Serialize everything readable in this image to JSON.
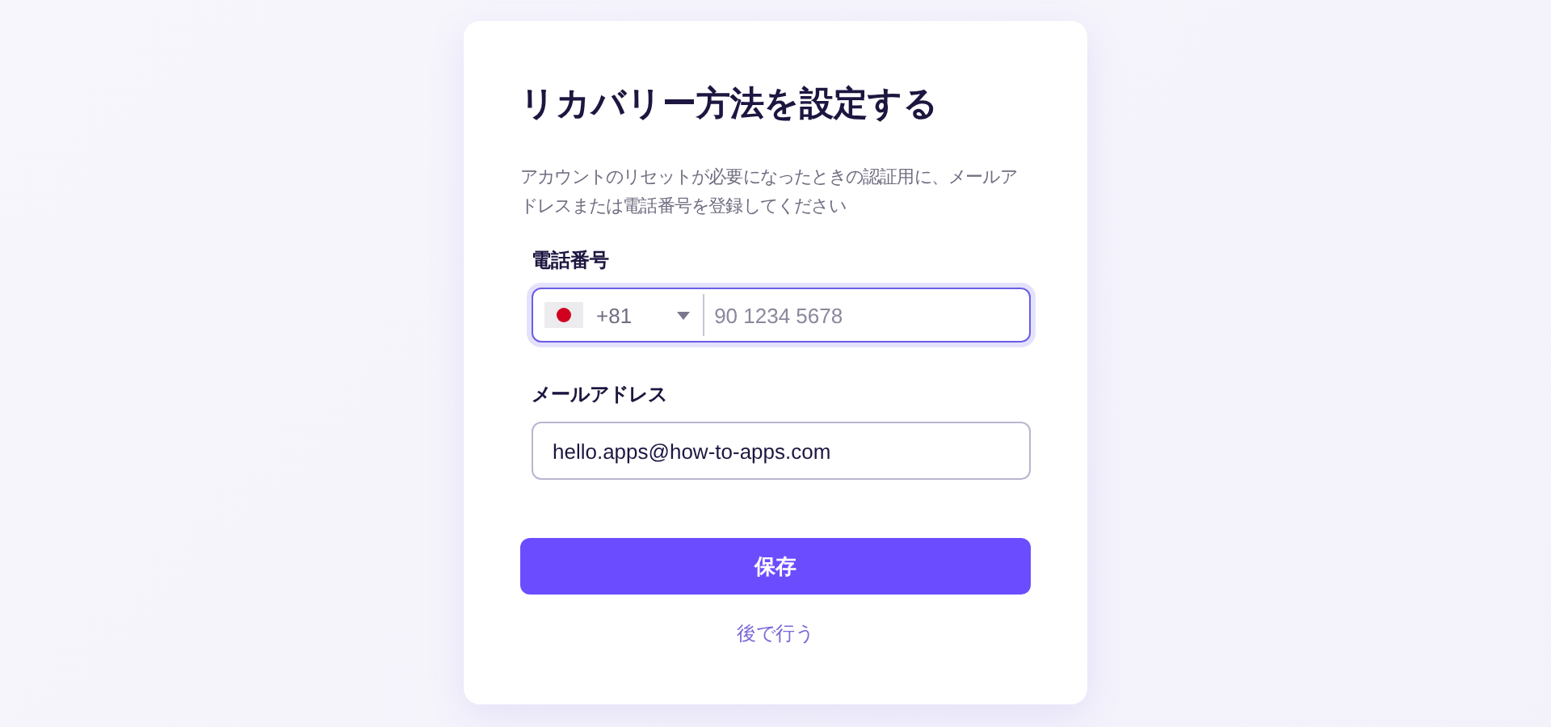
{
  "title": "リカバリー方法を設定する",
  "description": "アカウントのリセットが必要になったときの認証用に、メールアドレスまたは電話番号を登録してください",
  "phone": {
    "label": "電話番号",
    "country_code": "+81",
    "placeholder": "90 1234 5678",
    "focused": true
  },
  "email": {
    "label": "メールアドレス",
    "value": "hello.apps@how-to-apps.com",
    "focused": false
  },
  "save_button": "保存",
  "later_link": "後で行う"
}
